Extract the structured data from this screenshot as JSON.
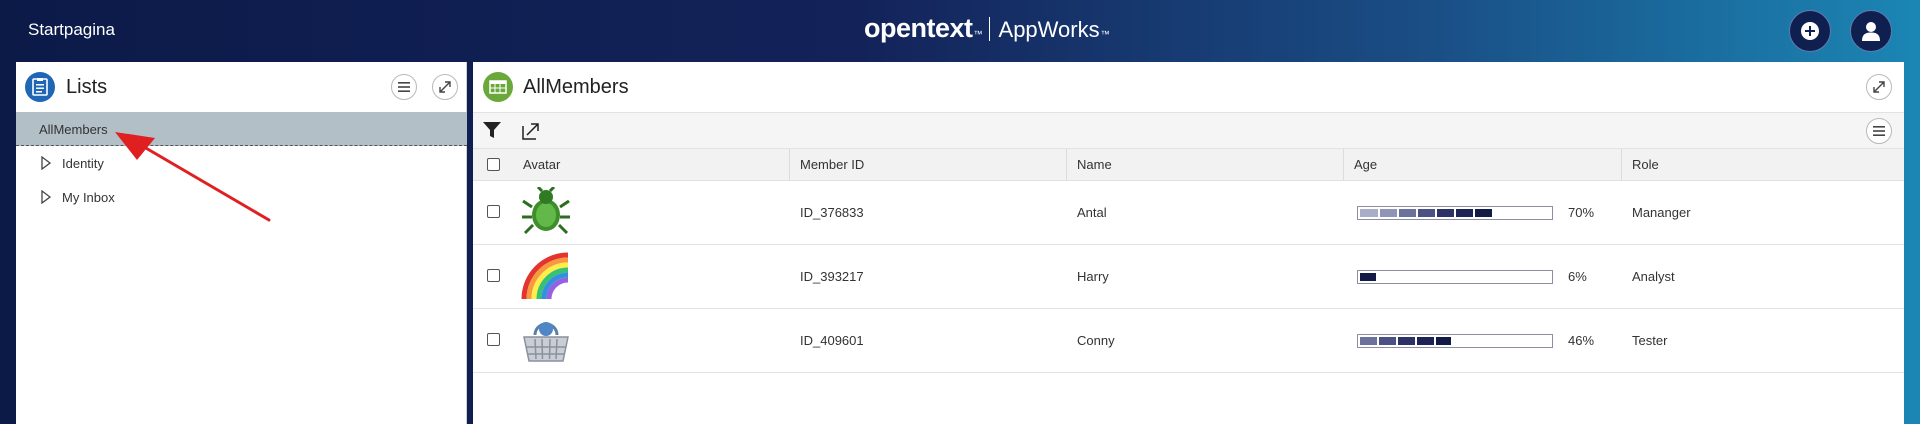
{
  "header": {
    "home_label": "Startpagina",
    "brand_name": "opentext",
    "brand_tm": "™",
    "brand_product": "AppWorks",
    "brand_product_tm": "™"
  },
  "lists_panel": {
    "title": "Lists",
    "items": [
      {
        "label": "AllMembers",
        "selected": true
      },
      {
        "label": "Identity",
        "expandable": true
      },
      {
        "label": "My Inbox",
        "expandable": true
      }
    ]
  },
  "main_panel": {
    "title": "AllMembers",
    "columns": [
      "Avatar",
      "Member ID",
      "Name",
      "Age",
      "Role"
    ],
    "rows": [
      {
        "avatar_icon": "bug-icon",
        "member_id": "ID_376833",
        "name": "Antal",
        "age_percent": 70,
        "age_label": "70%",
        "role": "Mananger"
      },
      {
        "avatar_icon": "rainbow-icon",
        "member_id": "ID_393217",
        "name": "Harry",
        "age_percent": 6,
        "age_label": "6%",
        "role": "Analyst"
      },
      {
        "avatar_icon": "basket-icon",
        "member_id": "ID_409601",
        "name": "Conny",
        "age_percent": 46,
        "age_label": "46%",
        "role": "Tester"
      }
    ]
  },
  "colors": {
    "selected_row": "#b3bfc6",
    "lists_icon": "#1f67b5",
    "table_icon": "#6aa83a",
    "bar_segment_dark": "#141a46"
  }
}
